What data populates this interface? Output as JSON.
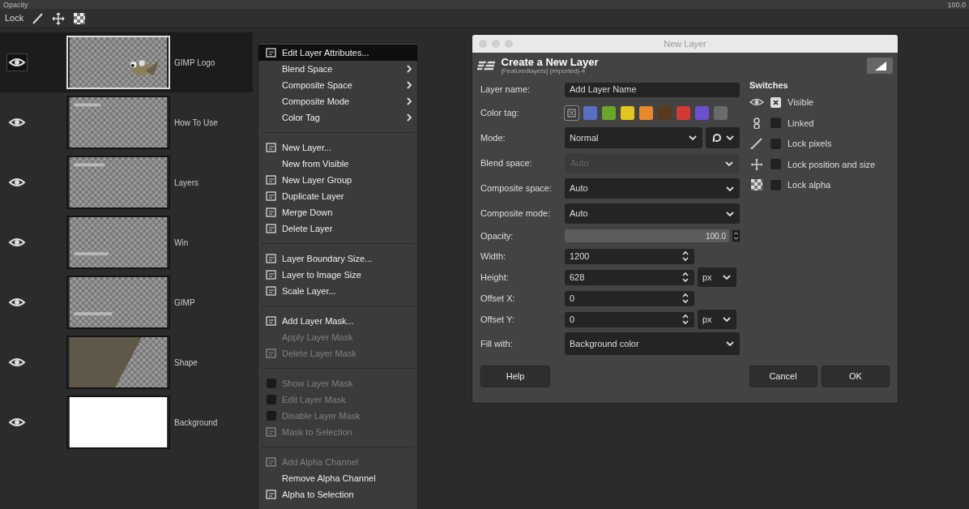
{
  "top_bar": {
    "label": "Opacity",
    "value": "100.0"
  },
  "lock_bar": {
    "label": "Lock"
  },
  "layers": [
    {
      "name": "GIMP Logo",
      "visible": true,
      "selected": true,
      "kind": "picture"
    },
    {
      "name": "How To Use",
      "visible": true,
      "selected": false,
      "kind": "picture"
    },
    {
      "name": "Layers",
      "visible": true,
      "selected": false,
      "kind": "picture"
    },
    {
      "name": "Win",
      "visible": true,
      "selected": false,
      "kind": "picture"
    },
    {
      "name": "GIMP",
      "visible": true,
      "selected": false,
      "kind": "picture"
    },
    {
      "name": "Shape",
      "visible": true,
      "selected": false,
      "kind": "picture"
    },
    {
      "name": "Background",
      "visible": true,
      "selected": false,
      "kind": "picture"
    }
  ],
  "context_menu": {
    "groups": [
      [
        {
          "label": "Edit Layer Attributes...",
          "kind": "command",
          "has_icon": true,
          "disabled": false,
          "submenu": false,
          "selected": true
        },
        {
          "label": "Blend Space",
          "kind": "command",
          "has_icon": false,
          "disabled": false,
          "submenu": true,
          "selected": false
        },
        {
          "label": "Composite Space",
          "kind": "command",
          "has_icon": false,
          "disabled": false,
          "submenu": true,
          "selected": false
        },
        {
          "label": "Composite Mode",
          "kind": "command",
          "has_icon": false,
          "disabled": false,
          "submenu": true,
          "selected": false
        },
        {
          "label": "Color Tag",
          "kind": "command",
          "has_icon": false,
          "disabled": false,
          "submenu": true,
          "selected": false
        }
      ],
      [
        {
          "label": "New Layer...",
          "kind": "command",
          "has_icon": true,
          "disabled": false,
          "submenu": false,
          "selected": false
        },
        {
          "label": "New from Visible",
          "kind": "command",
          "has_icon": false,
          "disabled": false,
          "submenu": false,
          "selected": false
        },
        {
          "label": "New Layer Group",
          "kind": "command",
          "has_icon": true,
          "disabled": false,
          "submenu": false,
          "selected": false
        },
        {
          "label": "Duplicate Layer",
          "kind": "command",
          "has_icon": true,
          "disabled": false,
          "submenu": false,
          "selected": false
        },
        {
          "label": "Merge Down",
          "kind": "command",
          "has_icon": true,
          "disabled": false,
          "submenu": false,
          "selected": false
        },
        {
          "label": "Delete Layer",
          "kind": "command",
          "has_icon": true,
          "disabled": false,
          "submenu": false,
          "selected": false
        }
      ],
      [
        {
          "label": "Layer Boundary Size...",
          "kind": "command",
          "has_icon": true,
          "disabled": false,
          "submenu": false,
          "selected": false
        },
        {
          "label": "Layer to Image Size",
          "kind": "command",
          "has_icon": true,
          "disabled": false,
          "submenu": false,
          "selected": false
        },
        {
          "label": "Scale Layer...",
          "kind": "command",
          "has_icon": true,
          "disabled": false,
          "submenu": false,
          "selected": false
        }
      ],
      [
        {
          "label": "Add Layer Mask...",
          "kind": "command",
          "has_icon": true,
          "disabled": false,
          "submenu": false,
          "selected": false
        },
        {
          "label": "Apply Layer Mask",
          "kind": "command",
          "has_icon": false,
          "disabled": true,
          "submenu": false,
          "selected": false
        },
        {
          "label": "Delete Layer Mask",
          "kind": "command",
          "has_icon": true,
          "disabled": true,
          "submenu": false,
          "selected": false
        }
      ],
      [
        {
          "label": "Show Layer Mask",
          "kind": "check",
          "checked": false,
          "disabled": true,
          "selected": false
        },
        {
          "label": "Edit Layer Mask",
          "kind": "check",
          "checked": false,
          "disabled": true,
          "selected": false
        },
        {
          "label": "Disable Layer Mask",
          "kind": "check",
          "checked": false,
          "disabled": true,
          "selected": false
        },
        {
          "label": "Mask to Selection",
          "kind": "command",
          "has_icon": true,
          "disabled": true,
          "submenu": false,
          "selected": false
        }
      ],
      [
        {
          "label": "Add Alpha Channel",
          "kind": "command",
          "has_icon": true,
          "disabled": true,
          "submenu": false,
          "selected": false
        },
        {
          "label": "Remove Alpha Channel",
          "kind": "command",
          "has_icon": false,
          "disabled": false,
          "submenu": false,
          "selected": false
        },
        {
          "label": "Alpha to Selection",
          "kind": "command",
          "has_icon": true,
          "disabled": false,
          "submenu": false,
          "selected": false
        }
      ]
    ]
  },
  "dialog": {
    "window_title": "New Layer",
    "heading": "Create a New Layer",
    "subheading": "[Featuredlayers] (imported)-4",
    "fields": [
      {
        "kind": "text",
        "label": "Layer name:",
        "value": "Add Layer Name"
      },
      {
        "kind": "colortags",
        "label": "Color tag:",
        "tags": [
          {
            "color": "#3a3a3a",
            "none": true,
            "selected": true
          },
          {
            "color": "#5a6fc4",
            "none": false,
            "selected": false
          },
          {
            "color": "#6aa52c",
            "none": false,
            "selected": false
          },
          {
            "color": "#e3c520",
            "none": false,
            "selected": false
          },
          {
            "color": "#e8892a",
            "none": false,
            "selected": false
          },
          {
            "color": "#5a3a1c",
            "none": false,
            "selected": false
          },
          {
            "color": "#d23a34",
            "none": false,
            "selected": false
          },
          {
            "color": "#6a4fd0",
            "none": false,
            "selected": false
          },
          {
            "color": "#6a6a6a",
            "none": false,
            "selected": false
          }
        ]
      },
      {
        "kind": "mode",
        "label": "Mode:",
        "value": "Normal",
        "disabled": false
      },
      {
        "kind": "select",
        "label": "Blend space:",
        "value": "Auto",
        "disabled": true
      },
      {
        "kind": "select",
        "label": "Composite space:",
        "value": "Auto",
        "disabled": false
      },
      {
        "kind": "select",
        "label": "Composite mode:",
        "value": "Auto",
        "disabled": false
      },
      {
        "kind": "slider",
        "label": "Opacity:",
        "value": "100.0",
        "level": 1.0
      },
      {
        "kind": "spin",
        "label": "Width:",
        "value": "1200"
      },
      {
        "kind": "spin",
        "label": "Height:",
        "value": "628",
        "unit": "px"
      },
      {
        "kind": "spin",
        "label": "Offset X:",
        "value": "0"
      },
      {
        "kind": "spin",
        "label": "Offset Y:",
        "value": "0",
        "unit": "px"
      },
      {
        "kind": "select",
        "label": "Fill with:",
        "value": "Background color",
        "disabled": false
      }
    ],
    "switches": {
      "title": "Switches",
      "items": [
        {
          "label": "Visible",
          "checked": true
        },
        {
          "label": "Linked",
          "checked": false
        },
        {
          "label": "Lock pixels",
          "checked": false
        },
        {
          "label": "Lock position and size",
          "checked": false
        },
        {
          "label": "Lock alpha",
          "checked": false
        }
      ]
    },
    "buttons": {
      "left": [
        "Help"
      ],
      "right": [
        "Cancel",
        "OK"
      ]
    }
  }
}
